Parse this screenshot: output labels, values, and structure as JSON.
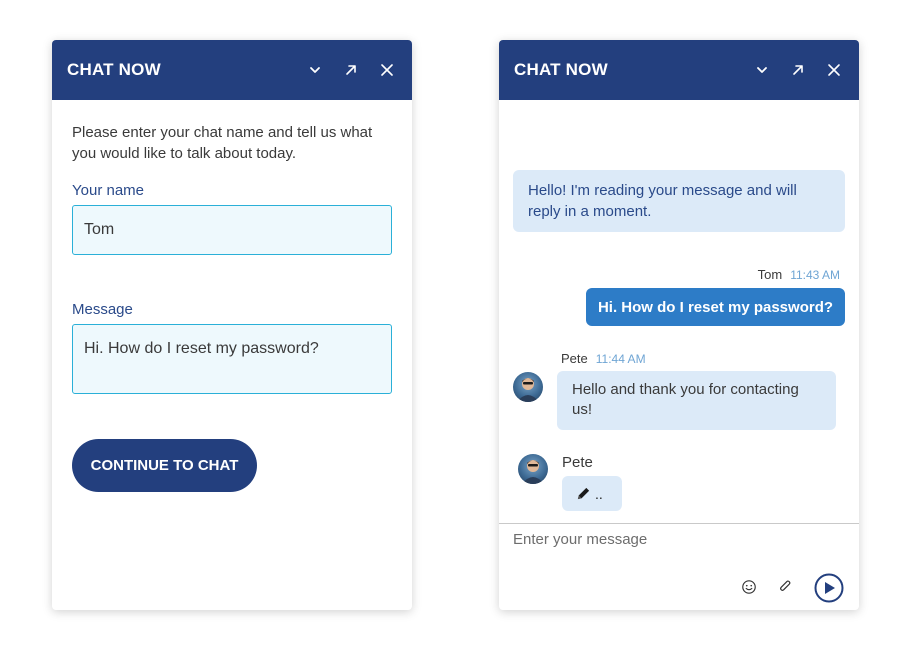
{
  "left_panel": {
    "title": "CHAT NOW",
    "intro": "Please enter your chat name and tell us what you would like to talk about today.",
    "name_label": "Your name",
    "name_value": "Tom",
    "message_label": "Message",
    "message_value": "Hi. How do I reset my password?",
    "cta_label": "CONTINUE TO CHAT"
  },
  "right_panel": {
    "title": "CHAT NOW",
    "messages": [
      {
        "sender": "",
        "time": "",
        "text": "Hello! I'm reading your message and will reply in a moment."
      },
      {
        "sender": "Tom",
        "time": "11:43 AM",
        "text": "Hi. How do I reset my password?"
      },
      {
        "sender": "Pete",
        "time": "11:44 AM",
        "text": "Hello and thank you for contacting us!"
      }
    ],
    "typing": {
      "sender": "Pete",
      "text": ".."
    },
    "composer_placeholder": "Enter your message"
  },
  "icons": {
    "minimize": "chevron-down-icon",
    "popout": "arrow-up-right-icon",
    "close": "close-icon",
    "emoji": "smiley-icon",
    "attach": "paperclip-icon",
    "send": "send-icon",
    "typing": "pencil-icon"
  },
  "colors": {
    "header": "#233f7e",
    "agent_bubble": "#dceaf8",
    "user_bubble": "#2d7cc7",
    "input_border": "#2ab0d8",
    "input_bg": "#eef9fd",
    "timestamp": "#6fa5d4"
  }
}
